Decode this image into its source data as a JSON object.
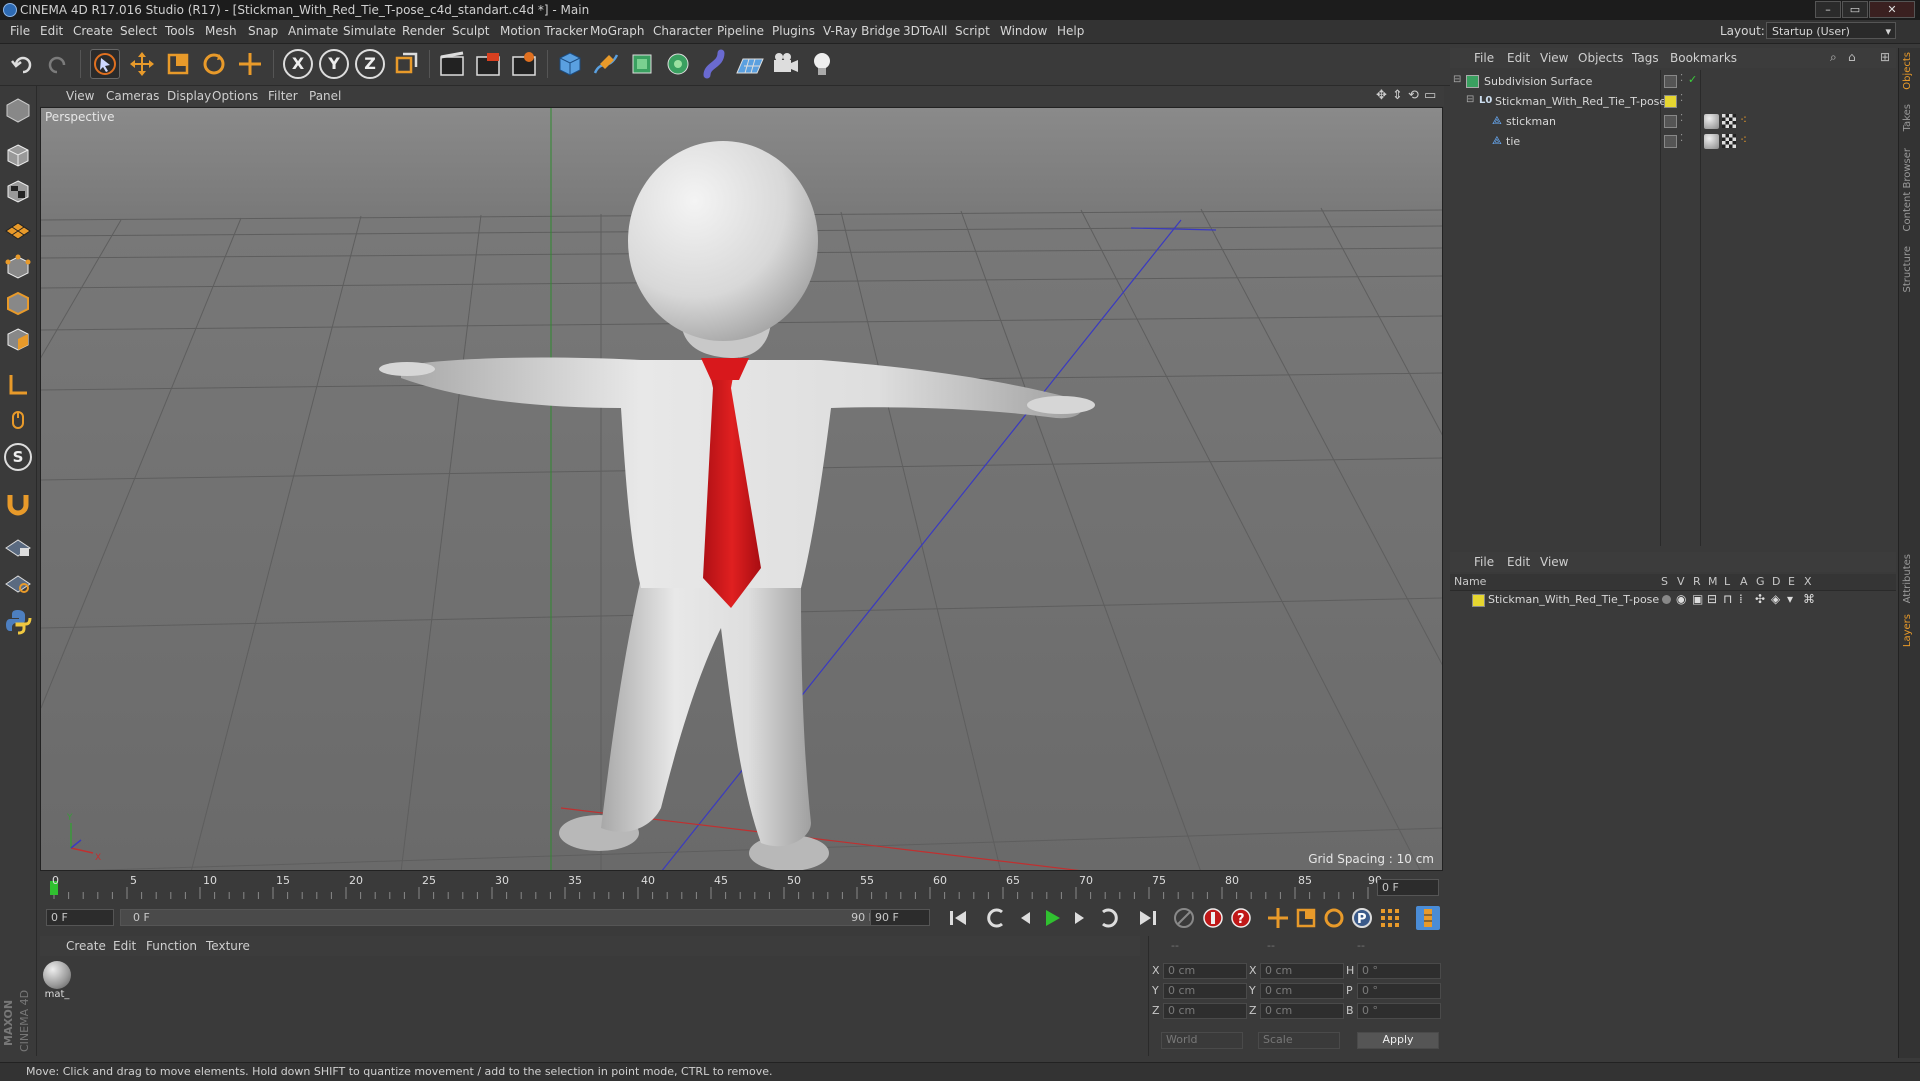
{
  "window": {
    "title": "CINEMA 4D R17.016 Studio (R17) - [Stickman_With_Red_Tie_T-pose_c4d_standart.c4d *] - Main",
    "controls": [
      "–",
      "▭",
      "✕"
    ]
  },
  "menubar": {
    "items": [
      "File",
      "Edit",
      "Create",
      "Select",
      "Tools",
      "Mesh",
      "Snap",
      "Animate",
      "Simulate",
      "Render",
      "Sculpt",
      "Motion Tracker",
      "MoGraph",
      "Character",
      "Pipeline",
      "Plugins",
      "V-Ray Bridge",
      "3DToAll",
      "Script",
      "Window",
      "Help"
    ],
    "layout_label": "Layout:",
    "layout_value": "Startup (User)"
  },
  "toolbar": {
    "axis_x": "X",
    "axis_y": "Y",
    "axis_z": "Z"
  },
  "left_toolbar": {
    "sculpt_s": "S"
  },
  "viewport": {
    "menu": [
      "View",
      "Cameras",
      "Display",
      "Options",
      "Filter",
      "Panel"
    ],
    "label": "Perspective",
    "grid_spacing": "Grid Spacing : 10 cm",
    "axis_x": "X",
    "axis_y": "Y"
  },
  "timeline": {
    "ticks": [
      "0",
      "5",
      "10",
      "15",
      "20",
      "25",
      "30",
      "35",
      "40",
      "45",
      "50",
      "55",
      "60",
      "65",
      "70",
      "75",
      "80",
      "85",
      "90"
    ],
    "current_frame": "0 F",
    "start_field": "0 F",
    "range_start": "0 F",
    "range_end": "90 F",
    "end_field": "90 F"
  },
  "material_manager": {
    "menu": [
      "Create",
      "Edit",
      "Function",
      "Texture"
    ],
    "materials": [
      {
        "name": "mat_"
      }
    ]
  },
  "coordinates": {
    "header": [
      "--",
      "--",
      "--"
    ],
    "rows": [
      {
        "a_label": "X",
        "a_val": "0 cm",
        "b_label": "X",
        "b_val": "0 cm",
        "c_label": "H",
        "c_val": "0 °"
      },
      {
        "a_label": "Y",
        "a_val": "0 cm",
        "b_label": "Y",
        "b_val": "0 cm",
        "c_label": "P",
        "c_val": "0 °"
      },
      {
        "a_label": "Z",
        "a_val": "0 cm",
        "b_label": "Z",
        "b_val": "0 cm",
        "c_label": "B",
        "c_val": "0 °"
      }
    ],
    "world": "World",
    "scale": "Scale",
    "apply": "Apply"
  },
  "object_manager": {
    "menu": [
      "File",
      "Edit",
      "View",
      "Objects",
      "Tags",
      "Bookmarks"
    ],
    "objects": [
      {
        "name": "Subdivision Surface"
      },
      {
        "name": "Stickman_With_Red_Tie_T-pose"
      },
      {
        "name": "stickman"
      },
      {
        "name": "tie"
      }
    ]
  },
  "layer_manager": {
    "menu": [
      "File",
      "Edit",
      "View"
    ],
    "columns": [
      "Name",
      "S",
      "V",
      "R",
      "M",
      "L",
      "A",
      "G",
      "D",
      "E",
      "X"
    ],
    "layers": [
      {
        "name": "Stickman_With_Red_Tie_T-pose",
        "color": "#e6d630"
      }
    ]
  },
  "right_tabs": [
    "Objects",
    "Takes",
    "Content Browser",
    "Structure",
    "Attributes",
    "Layers"
  ],
  "brand": {
    "maxon": "MAXON",
    "c4d": "CINEMA 4D"
  },
  "status": "Move: Click and drag to move elements. Hold down SHIFT to quantize movement / add to the selection in point mode, CTRL to remove.",
  "colors": {
    "accent": "#4a8cd6",
    "tie_red": "#d0181b",
    "layer_yellow": "#e6d630"
  }
}
